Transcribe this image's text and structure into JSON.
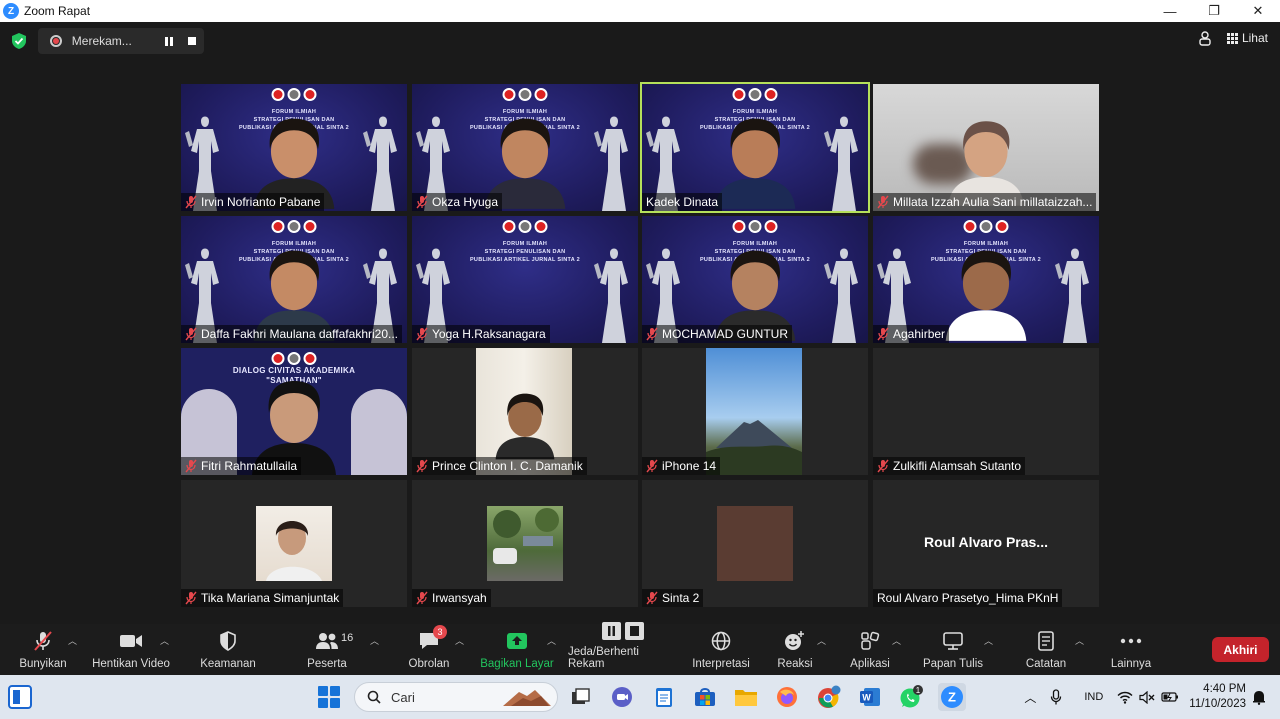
{
  "window": {
    "title": "Zoom Rapat",
    "minimize": "—",
    "maximize": "❐",
    "close": "✕"
  },
  "recording": {
    "label": "Merekam..."
  },
  "view": {
    "label": "Lihat"
  },
  "participants": [
    {
      "name": "Irvin Nofrianto Pabane",
      "muted": true,
      "bg": "forum"
    },
    {
      "name": "Okza Hyuga",
      "muted": true,
      "bg": "forum"
    },
    {
      "name": "Kadek Dinata",
      "muted": false,
      "bg": "forum",
      "active": true
    },
    {
      "name": "Millata Izzah Aulia Sani millataizzah...",
      "muted": true,
      "bg": "room"
    },
    {
      "name": "Daffa Fakhri Maulana daffafakhri20...",
      "muted": true,
      "bg": "forum"
    },
    {
      "name": "Yoga H.Raksanagara",
      "muted": true,
      "bg": "forum"
    },
    {
      "name": "MOCHAMAD GUNTUR",
      "muted": true,
      "bg": "forum"
    },
    {
      "name": "Agahirber",
      "muted": true,
      "bg": "forum"
    },
    {
      "name": "Fitri Rahmatullaila",
      "muted": true,
      "bg": "dialog"
    },
    {
      "name": "Prince Clinton I. C. Damanik",
      "muted": true,
      "bg": "wall"
    },
    {
      "name": "iPhone 14",
      "muted": true,
      "bg": "mountain"
    },
    {
      "name": "Zulkifli Alamsah Sutanto",
      "muted": true,
      "bg": "none"
    },
    {
      "name": "Tika Mariana Simanjuntak",
      "muted": true,
      "bg": "photo"
    },
    {
      "name": "Irwansyah",
      "muted": true,
      "bg": "park"
    },
    {
      "name": "Sinta 2",
      "muted": true,
      "bg": "brown"
    },
    {
      "name": "Roul Alvaro Prasetyo_Hima PKnH",
      "muted": false,
      "bg": "name",
      "display": "Roul Alvaro Pras..."
    }
  ],
  "forum_slide": {
    "line1": "FORUM ILMIAH",
    "line2": "STRATEGI PENULISAN DAN",
    "line3": "PUBLIKASI ARTIKEL JURNAL SINTA 2"
  },
  "dialog_slide": {
    "line1": "DIALOG CIVITAS AKADEMIKA",
    "line2": "\"SAMATHAN\""
  },
  "toolbar": {
    "unmute": "Bunyikan",
    "stop_video": "Hentikan Video",
    "security": "Keamanan",
    "participants": "Peserta",
    "participants_count": "16",
    "chat": "Obrolan",
    "chat_badge": "3",
    "share": "Bagikan Layar",
    "record": "Jeda/Berhenti Rekam",
    "interpretation": "Interpretasi",
    "reactions": "Reaksi",
    "apps": "Aplikasi",
    "whiteboard": "Papan Tulis",
    "notes": "Catatan",
    "more": "Lainnya",
    "end": "Akhiri"
  },
  "taskbar": {
    "search_placeholder": "Cari",
    "whatsapp_badge": "1",
    "language": "IND",
    "time": "4:40 PM",
    "date": "11/10/2023"
  },
  "colors": {
    "accent_green": "#22c55e",
    "active_speaker": "#b5e05a",
    "end_red": "#c4232b",
    "zoom_blue": "#2d8cff"
  }
}
